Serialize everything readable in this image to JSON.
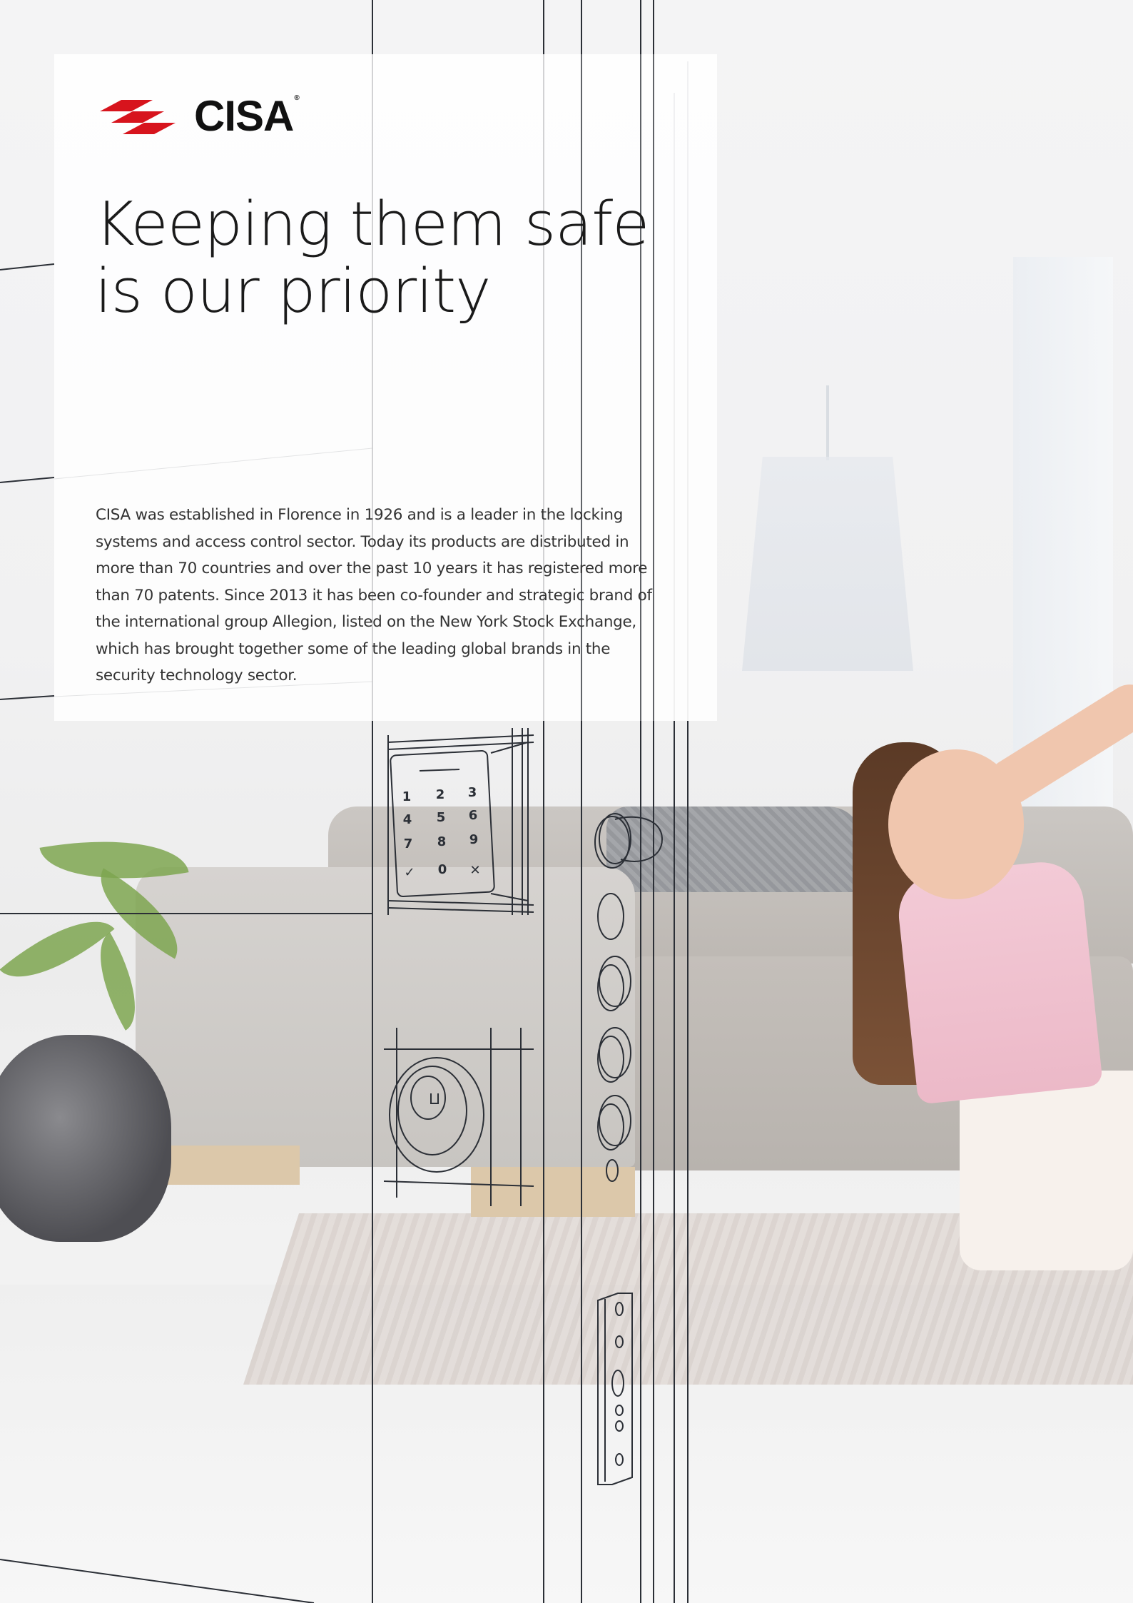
{
  "brand": {
    "name": "CISA",
    "registered_mark": "®",
    "colors": {
      "logo_mark": "#d7141d",
      "wordmark": "#111111",
      "headline": "#1a1a1a",
      "body": "#333333",
      "line_art": "#2b2f36"
    }
  },
  "headline": {
    "line1": "Keeping them safe",
    "line2": "is our priority"
  },
  "body": {
    "paragraph": "CISA was established in Florence in 1926 and is a leader in the locking systems and access control sector. Today its products are distributed in more than 70 countries and over the past 10 years it has registered more than 70 patents. Since 2013 it has been co-founder and strategic brand of the international group Allegion, listed on the New York Stock Exchange, which has brought together some of the leading global brands in the security technology sector."
  },
  "keypad": {
    "keys": [
      "1",
      "2",
      "3",
      "4",
      "5",
      "6",
      "7",
      "8",
      "9",
      "✓",
      "0",
      "✕"
    ]
  },
  "illustration": {
    "icons": [
      "keypad-lock-icon",
      "cylinder-lock-icon",
      "door-handle-icon",
      "multipoint-bolt-icon",
      "strike-plate-icon"
    ]
  }
}
